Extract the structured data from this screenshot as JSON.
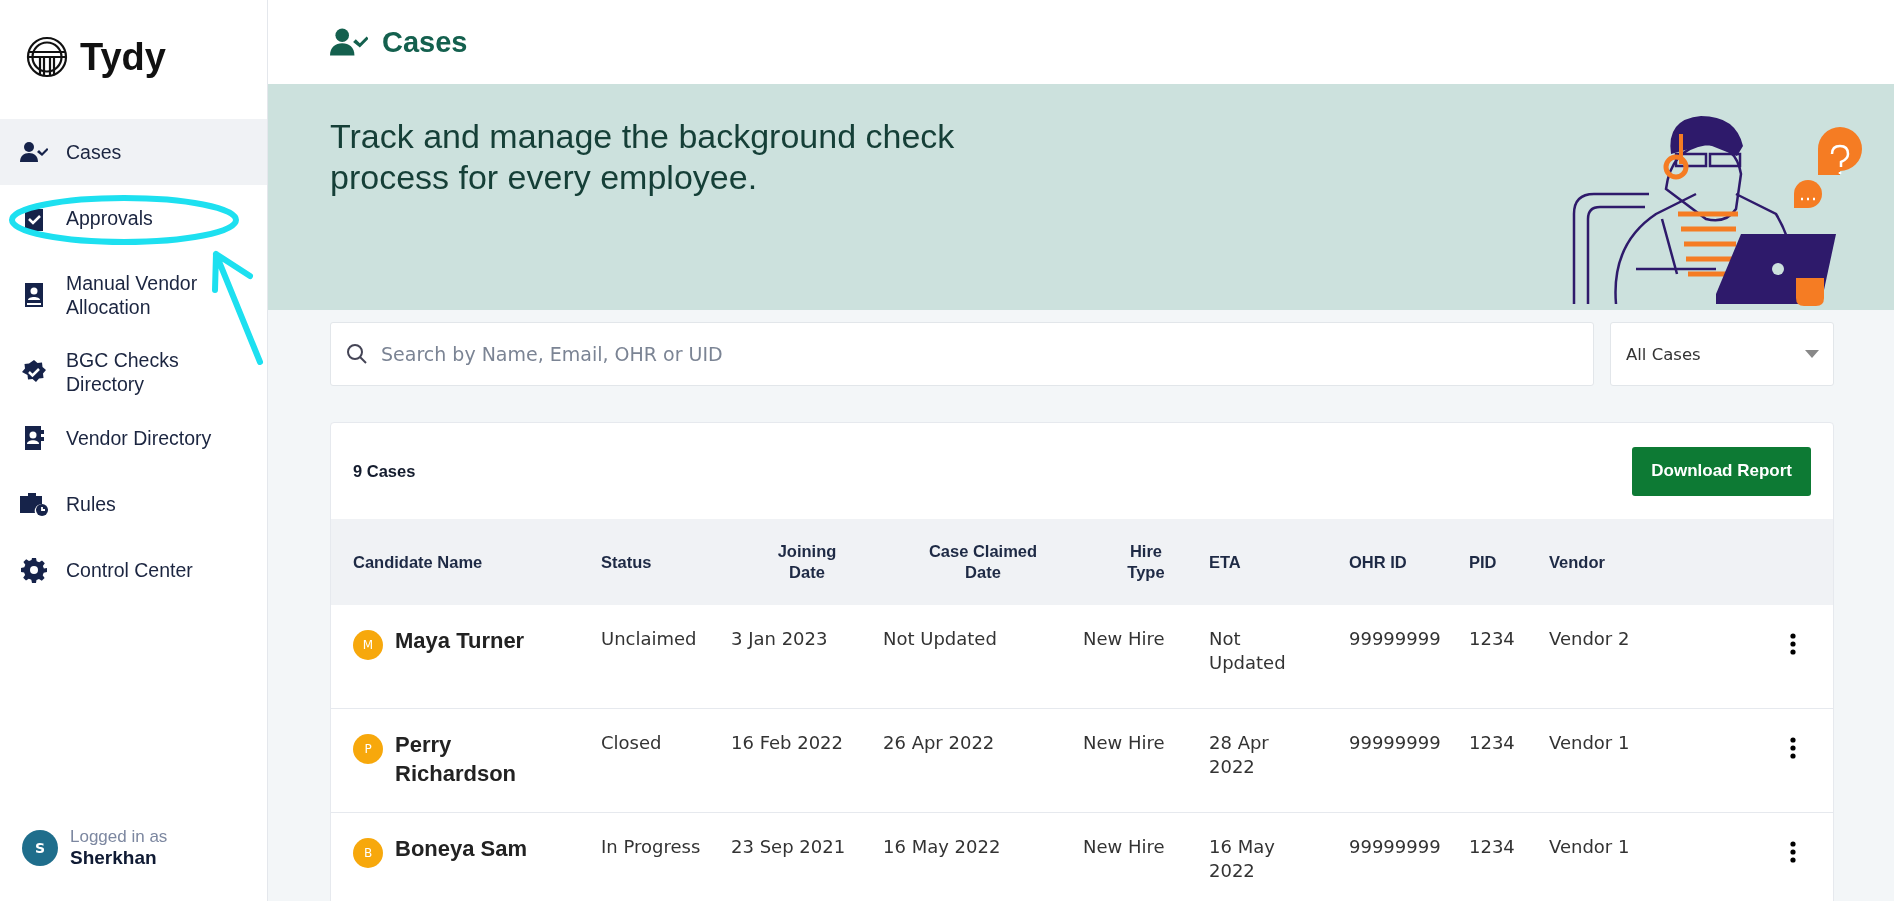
{
  "brand": {
    "name": "Tydy"
  },
  "sidebar": {
    "items": [
      {
        "label": "Cases",
        "selected": true
      },
      {
        "label": "Approvals",
        "selected": false
      },
      {
        "label": "Manual Vendor Allocation",
        "selected": false
      },
      {
        "label": "BGC Checks Directory",
        "selected": false
      },
      {
        "label": "Vendor Directory",
        "selected": false
      },
      {
        "label": "Rules",
        "selected": false
      },
      {
        "label": "Control Center",
        "selected": false
      }
    ],
    "user": {
      "initial": "S",
      "caption": "Logged in as",
      "name": "Sherkhan"
    }
  },
  "page": {
    "title": "Cases"
  },
  "banner": {
    "text": "Track and manage the background check process for every employee."
  },
  "search": {
    "placeholder": "Search by Name, Email, OHR or UID"
  },
  "filter": {
    "value": "All Cases"
  },
  "cases": {
    "count": "9 Cases",
    "download_button": "Download Report",
    "columns": [
      "Candidate Name",
      "Status",
      "Joining Date",
      "Case Claimed Date",
      "Hire Type",
      "ETA",
      "OHR ID",
      "PID",
      "Vendor"
    ],
    "rows": [
      {
        "initial": "M",
        "name": "Maya Turner",
        "status": "Unclaimed",
        "joining_date": "3 Jan 2023",
        "claimed_date": "Not Updated",
        "hire_type": "New Hire",
        "eta": "Not Updated",
        "ohr_id": "99999999",
        "pid": "1234",
        "vendor": "Vendor 2"
      },
      {
        "initial": "P",
        "name": "Perry Richardson",
        "status": "Closed",
        "joining_date": "16 Feb 2022",
        "claimed_date": "26 Apr 2022",
        "hire_type": "New Hire",
        "eta": "28 Apr 2022",
        "ohr_id": "99999999",
        "pid": "1234",
        "vendor": "Vendor 1"
      },
      {
        "initial": "B",
        "name": "Boneya Sam",
        "status": "In Progress",
        "joining_date": "23 Sep 2021",
        "claimed_date": "16 May 2022",
        "hire_type": "New Hire",
        "eta": "16 May 2022",
        "ohr_id": "99999999",
        "pid": "1234",
        "vendor": "Vendor 1"
      }
    ]
  }
}
